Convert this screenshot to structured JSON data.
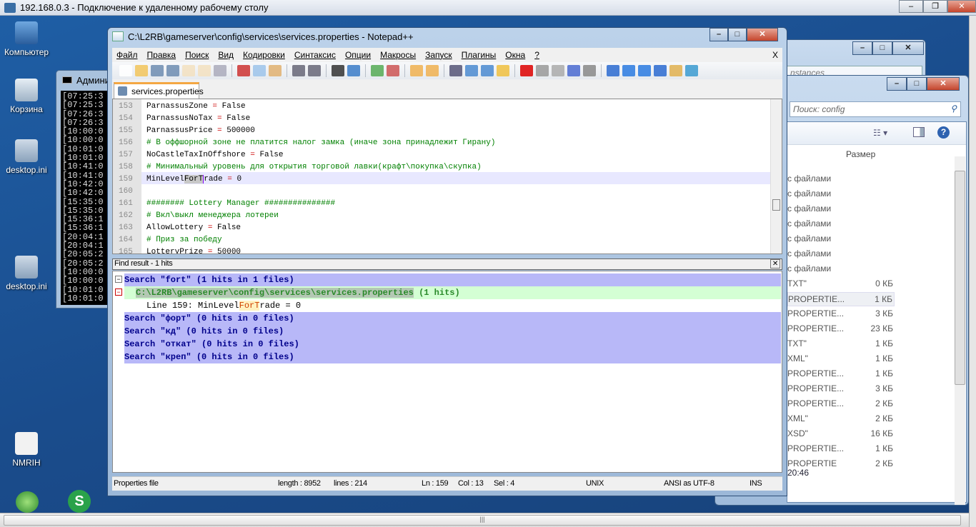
{
  "rdp": {
    "title": "192.168.0.3 - Подключение к удаленному рабочему столу"
  },
  "desktop": {
    "icons": [
      {
        "label": "Компьютер"
      },
      {
        "label": "Корзина"
      },
      {
        "label": "desktop.ini"
      },
      {
        "label": "desktop.ini"
      },
      {
        "label": "NMRIH"
      }
    ]
  },
  "console": {
    "title": "Админи",
    "lines": [
      "[07:25:3",
      "[07:25:3",
      "[07:26:3",
      "[07:26:3",
      "[10:00:0",
      "[10:00:0",
      "[10:01:0",
      "[10:01:0",
      "[10:41:0",
      "[10:41:0",
      "[10:42:0",
      "[10:42:0",
      "[15:35:0",
      "[15:35:0",
      "[15:36:1",
      "[15:36:1",
      "[20:04:1",
      "[20:04:1",
      "[20:05:2",
      "[20:05:2",
      "[10:00:0",
      "[10:00:0",
      "[10:01:0",
      "[10:01:0"
    ]
  },
  "explorer_back": {
    "search_placeholder": "nstances"
  },
  "explorer": {
    "search_placeholder": "Поиск: config",
    "column_size": "Размер",
    "rows": [
      {
        "type": "с файлами",
        "size": ""
      },
      {
        "type": "с файлами",
        "size": ""
      },
      {
        "type": "с файлами",
        "size": ""
      },
      {
        "type": "с файлами",
        "size": ""
      },
      {
        "type": "с файлами",
        "size": ""
      },
      {
        "type": "с файлами",
        "size": ""
      },
      {
        "type": "с файлами",
        "size": ""
      },
      {
        "type": "TXT\"",
        "size": "0 КБ"
      },
      {
        "type": "PROPERTIE...",
        "size": "1 КБ"
      },
      {
        "type": "PROPERTIE...",
        "size": "3 КБ"
      },
      {
        "type": "PROPERTIE...",
        "size": "23 КБ"
      },
      {
        "type": "TXT\"",
        "size": "1 КБ"
      },
      {
        "type": "XML\"",
        "size": "1 КБ"
      },
      {
        "type": "PROPERTIE...",
        "size": "1 КБ"
      },
      {
        "type": "PROPERTIE...",
        "size": "3 КБ"
      },
      {
        "type": "PROPERTIE...",
        "size": "2 КБ"
      },
      {
        "type": "XML\"",
        "size": "2 КБ"
      },
      {
        "type": "XSD\"",
        "size": "16 КБ"
      },
      {
        "type": "PROPERTIE...",
        "size": "1 КБ"
      },
      {
        "type": "PROPERTIE",
        "size": "2 КБ"
      }
    ],
    "status_time": "20:46"
  },
  "npp": {
    "title": "C:\\L2RB\\gameserver\\config\\services\\services.properties - Notepad++",
    "menu": [
      "Файл",
      "Правка",
      "Поиск",
      "Вид",
      "Кодировки",
      "Синтаксис",
      "Опции",
      "Макросы",
      "Запуск",
      "Плагины",
      "Окна",
      "?"
    ],
    "close_doc": "X",
    "tab": "services.properties",
    "lines": [
      {
        "n": "153",
        "key": "ParnassusZone",
        "val": "False"
      },
      {
        "n": "154",
        "key": "ParnassusNoTax",
        "val": "False"
      },
      {
        "n": "155",
        "key": "ParnassusPrice",
        "val": "500000"
      },
      {
        "n": "156",
        "comment": "# В оффшорной зоне не платится налог замка (иначе зона принадлежит Гирану)"
      },
      {
        "n": "157",
        "key": "NoCastleTaxInOffshore",
        "val": "False"
      },
      {
        "n": "158",
        "comment": "# Минимальный уровень для открытия торговой лавки(крафт\\покупка\\скупка)"
      },
      {
        "n": "159",
        "key": "MinLevelForTrade",
        "val": "0"
      },
      {
        "n": "160"
      },
      {
        "n": "161",
        "comment": "######## Lottery Manager ###############"
      },
      {
        "n": "162",
        "comment": "# Вкл\\выкл менеджера лотереи"
      },
      {
        "n": "163",
        "key": "AllowLottery",
        "val": "False"
      },
      {
        "n": "164",
        "comment": "# Приз за победу"
      },
      {
        "n": "165",
        "key": "LotteryPrize",
        "val": "50000"
      }
    ],
    "find_header": "Find result - 1 hits",
    "find": {
      "s1": "Search \"fort\" (1 hits in 1 files)",
      "file": "C:\\L2RB\\gameserver\\config\\services\\services.properties",
      "file_hits": " (1 hits)",
      "hit_prefix": "Line 159: MinLevel",
      "hit_match": "ForT",
      "hit_suffix": "rade = 0",
      "s2": "Search \"форт\" (0 hits in 0 files)",
      "s3": "Search \"кд\" (0 hits in 0 files)",
      "s4": "Search \"откат\" (0 hits in 0 files)",
      "s5": "Search \"креп\" (0 hits in 0 files)"
    },
    "status": {
      "type": "Properties file",
      "length": "length : 8952",
      "lines": "lines : 214",
      "ln": "Ln : 159",
      "col": "Col : 13",
      "sel": "Sel : 4",
      "eol": "UNIX",
      "enc": "ANSI as UTF-8",
      "mode": "INS"
    }
  }
}
